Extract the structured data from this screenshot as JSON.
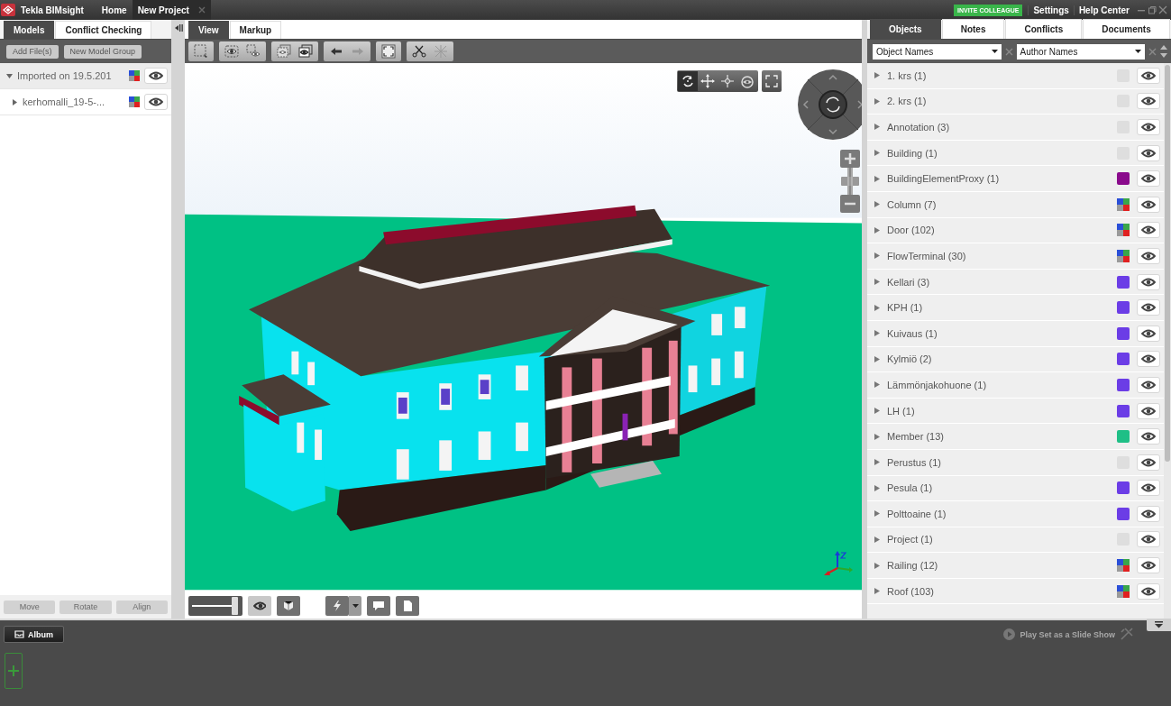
{
  "title_bar": {
    "app_name": "Tekla BIMsight",
    "tabs": [
      {
        "label": "Home",
        "selected": false,
        "closable": false
      },
      {
        "label": "New Project",
        "selected": true,
        "closable": true
      }
    ],
    "invite_button": "INVITE COLLEAGUE",
    "links": [
      "Settings",
      "Help Center"
    ]
  },
  "models_panel": {
    "tabs": [
      {
        "label": "Models",
        "selected": true
      },
      {
        "label": "Conflict Checking",
        "selected": false
      }
    ],
    "buttons": [
      "Add File(s)",
      "New Model Group"
    ],
    "tree": [
      {
        "label": "Imported on 19.5.201",
        "expanded": true,
        "selected": true,
        "children": [
          {
            "label": "kerhomalli_19-5-...",
            "expanded": false,
            "selected": false
          }
        ]
      }
    ],
    "footer_buttons": [
      {
        "label": "Move",
        "disabled": true
      },
      {
        "label": "Rotate",
        "disabled": true
      },
      {
        "label": "Align",
        "disabled": true
      }
    ]
  },
  "view_panel": {
    "tabs": [
      {
        "label": "View",
        "selected": true
      },
      {
        "label": "Markup",
        "selected": false
      }
    ],
    "transparency_slider": {
      "level": 0.92
    }
  },
  "objects_panel": {
    "tabs": [
      {
        "label": "Objects",
        "selected": true
      },
      {
        "label": "Notes",
        "selected": false
      },
      {
        "label": "Conflicts",
        "selected": false
      },
      {
        "label": "Documents",
        "selected": false
      }
    ],
    "filters": [
      {
        "value": "Object Names"
      },
      {
        "value": "Author Names"
      }
    ],
    "rows": [
      {
        "label": "1. krs (1)",
        "kind": "none"
      },
      {
        "label": "2. krs (1)",
        "kind": "none"
      },
      {
        "label": "Annotation (3)",
        "kind": "none"
      },
      {
        "label": "Building (1)",
        "kind": "none"
      },
      {
        "label": "BuildingElementProxy (1)",
        "kind": "solid",
        "color": "#8a0a8c"
      },
      {
        "label": "Column (7)",
        "kind": "multi"
      },
      {
        "label": "Door (102)",
        "kind": "multi"
      },
      {
        "label": "FlowTerminal (30)",
        "kind": "multi"
      },
      {
        "label": "Kellari (3)",
        "kind": "solid",
        "color": "#6b3de6"
      },
      {
        "label": "KPH (1)",
        "kind": "solid",
        "color": "#6b3de6"
      },
      {
        "label": "Kuivaus (1)",
        "kind": "solid",
        "color": "#6b3de6"
      },
      {
        "label": "Kylmiö (2)",
        "kind": "solid",
        "color": "#6b3de6"
      },
      {
        "label": "Lämmönjakohuone (1)",
        "kind": "solid",
        "color": "#6b3de6"
      },
      {
        "label": "LH (1)",
        "kind": "solid",
        "color": "#6b3de6"
      },
      {
        "label": "Member (13)",
        "kind": "solid",
        "color": "#1fbf86"
      },
      {
        "label": "Perustus (1)",
        "kind": "none"
      },
      {
        "label": "Pesula (1)",
        "kind": "solid",
        "color": "#6b3de6"
      },
      {
        "label": "Polttoaine (1)",
        "kind": "solid",
        "color": "#6b3de6"
      },
      {
        "label": "Project (1)",
        "kind": "none"
      },
      {
        "label": "Railing (12)",
        "kind": "multi"
      },
      {
        "label": "Roof (103)",
        "kind": "multi"
      }
    ]
  },
  "album_bar": {
    "album_button": "Album",
    "slideshow": "Play Set as a Slide Show"
  }
}
